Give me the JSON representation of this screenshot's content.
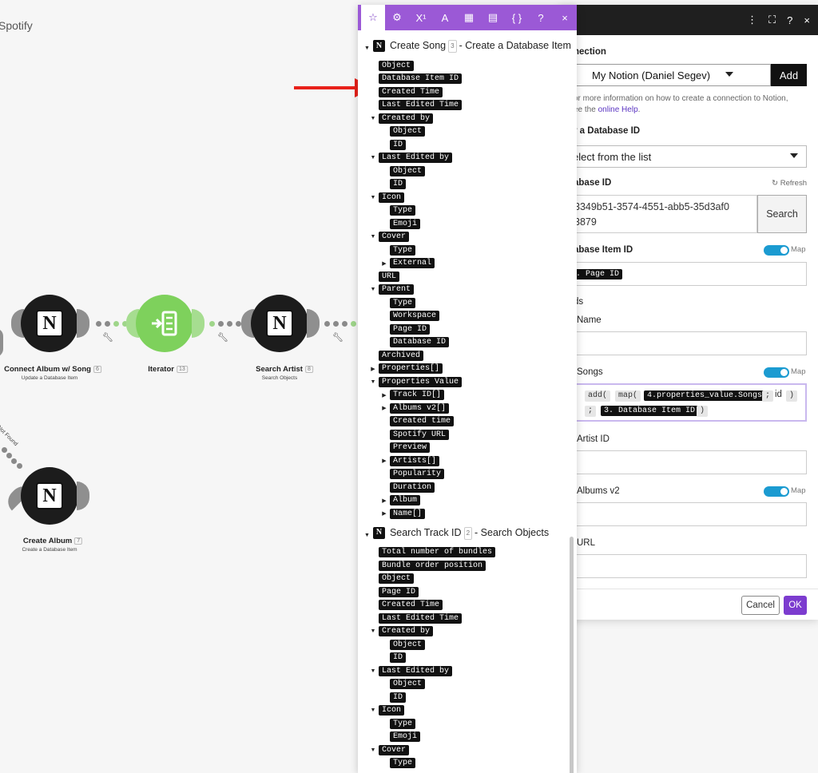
{
  "canvas": {
    "title": "Spotify",
    "nodes": [
      {
        "label": "Connect Album w/ Song",
        "badge": "6",
        "sub": "Update a Database Item"
      },
      {
        "label": "Iterator",
        "badge": "13",
        "sub": ""
      },
      {
        "label": "Search Artist",
        "badge": "8",
        "sub": "Search Objects"
      },
      {
        "label": "Create Album",
        "badge": "7",
        "sub": "Create a Database Item"
      }
    ],
    "route_label": "Not Found"
  },
  "colors": {
    "accent": "#9b59d6",
    "toggle": "#1b9bd1",
    "ok": "#7c3ccf"
  },
  "mapping": {
    "toolbar": {
      "icons": [
        "star-icon",
        "gear-icon",
        "superscript-icon",
        "text-icon",
        "calendar-icon",
        "table-icon",
        "braces-icon",
        "help-icon",
        "close-icon"
      ],
      "glyphs": [
        "☆",
        "⚙",
        "X¹",
        "A",
        "▦",
        "▤",
        "{ }",
        "?",
        "×"
      ]
    },
    "module1": {
      "title": "Create Song",
      "badge": "3",
      "desc": "- Create a Database Item"
    },
    "module1_items": [
      {
        "label": "Object",
        "level": 1,
        "caret": ""
      },
      {
        "label": "Database Item ID",
        "level": 1,
        "caret": ""
      },
      {
        "label": "Created Time",
        "level": 1,
        "caret": ""
      },
      {
        "label": "Last Edited Time",
        "level": 1,
        "caret": ""
      },
      {
        "label": "Created by",
        "level": 1,
        "caret": "down"
      },
      {
        "label": "Object",
        "level": 2,
        "caret": ""
      },
      {
        "label": "ID",
        "level": 2,
        "caret": ""
      },
      {
        "label": "Last Edited by",
        "level": 1,
        "caret": "down"
      },
      {
        "label": "Object",
        "level": 2,
        "caret": ""
      },
      {
        "label": "ID",
        "level": 2,
        "caret": ""
      },
      {
        "label": "Icon",
        "level": 1,
        "caret": "down"
      },
      {
        "label": "Type",
        "level": 2,
        "caret": ""
      },
      {
        "label": "Emoji",
        "level": 2,
        "caret": ""
      },
      {
        "label": "Cover",
        "level": 1,
        "caret": "down"
      },
      {
        "label": "Type",
        "level": 2,
        "caret": ""
      },
      {
        "label": "External",
        "level": 2,
        "caret": "right"
      },
      {
        "label": "URL",
        "level": 1,
        "caret": ""
      },
      {
        "label": "Parent",
        "level": 1,
        "caret": "down"
      },
      {
        "label": "Type",
        "level": 2,
        "caret": ""
      },
      {
        "label": "Workspace",
        "level": 2,
        "caret": ""
      },
      {
        "label": "Page ID",
        "level": 2,
        "caret": ""
      },
      {
        "label": "Database ID",
        "level": 2,
        "caret": ""
      },
      {
        "label": "Archived",
        "level": 1,
        "caret": ""
      },
      {
        "label": "Properties[]",
        "level": 1,
        "caret": "right"
      },
      {
        "label": "Properties Value",
        "level": 1,
        "caret": "down"
      },
      {
        "label": "Track ID[]",
        "level": 2,
        "caret": "right"
      },
      {
        "label": "Albums v2[]",
        "level": 2,
        "caret": "right"
      },
      {
        "label": "Created time",
        "level": 2,
        "caret": ""
      },
      {
        "label": "Spotify URL",
        "level": 2,
        "caret": ""
      },
      {
        "label": "Preview",
        "level": 2,
        "caret": ""
      },
      {
        "label": "Artists[]",
        "level": 2,
        "caret": "right"
      },
      {
        "label": "Popularity",
        "level": 2,
        "caret": ""
      },
      {
        "label": "Duration",
        "level": 2,
        "caret": ""
      },
      {
        "label": "Album",
        "level": 2,
        "caret": "right"
      },
      {
        "label": "Name[]",
        "level": 2,
        "caret": "right"
      }
    ],
    "module2": {
      "title": "Search Track ID",
      "badge": "2",
      "desc": "- Search Objects"
    },
    "module2_items": [
      {
        "label": "Total number of bundles",
        "level": 1,
        "caret": ""
      },
      {
        "label": "Bundle order position",
        "level": 1,
        "caret": ""
      },
      {
        "label": "Object",
        "level": 1,
        "caret": ""
      },
      {
        "label": "Page ID",
        "level": 1,
        "caret": ""
      },
      {
        "label": "Created Time",
        "level": 1,
        "caret": ""
      },
      {
        "label": "Last Edited Time",
        "level": 1,
        "caret": ""
      },
      {
        "label": "Created by",
        "level": 1,
        "caret": "down"
      },
      {
        "label": "Object",
        "level": 2,
        "caret": ""
      },
      {
        "label": "ID",
        "level": 2,
        "caret": ""
      },
      {
        "label": "Last Edited by",
        "level": 1,
        "caret": "down"
      },
      {
        "label": "Object",
        "level": 2,
        "caret": ""
      },
      {
        "label": "ID",
        "level": 2,
        "caret": ""
      },
      {
        "label": "Icon",
        "level": 1,
        "caret": "down"
      },
      {
        "label": "Type",
        "level": 2,
        "caret": ""
      },
      {
        "label": "Emoji",
        "level": 2,
        "caret": ""
      },
      {
        "label": "Cover",
        "level": 1,
        "caret": "down"
      },
      {
        "label": "Type",
        "level": 2,
        "caret": ""
      }
    ]
  },
  "settings": {
    "header_icons": [
      "⋮",
      "⛶",
      "?",
      "×"
    ],
    "connection_label": "nection",
    "connection_value": "My Notion (Daniel Segev)",
    "add_label": "Add",
    "help_text": "or more information on how to create a connection to Notion,",
    "help_text2": "ee the",
    "help_link": "online Help",
    "help_end": ".",
    "enter_db_label": "r a Database ID",
    "enter_db_value": "elect from the list",
    "db_id_label": "abase ID",
    "refresh_label": "Refresh",
    "db_id_value_1": "3349b51-3574-4551-abb5-35d3af0",
    "db_id_value_2": "3879",
    "search_label": "Search",
    "db_item_label": "abase Item ID",
    "map_label": "Map",
    "db_item_value": ". Page ID",
    "fields_label": "ds",
    "name_label": "Name",
    "songs_label": "Songs",
    "songs_tokens": {
      "add": "add(",
      "map": "map(",
      "prop": "4.properties_value.Songs",
      "sep1": ";",
      "id": "id",
      "close1": ")",
      "sep2": ";",
      "dbid": "3. Database Item ID",
      "close2": ")"
    },
    "artist_label": "Artist ID",
    "albums_label": "Albums v2",
    "url_label": "URL",
    "cancel_label": "Cancel",
    "ok_label": "OK"
  }
}
